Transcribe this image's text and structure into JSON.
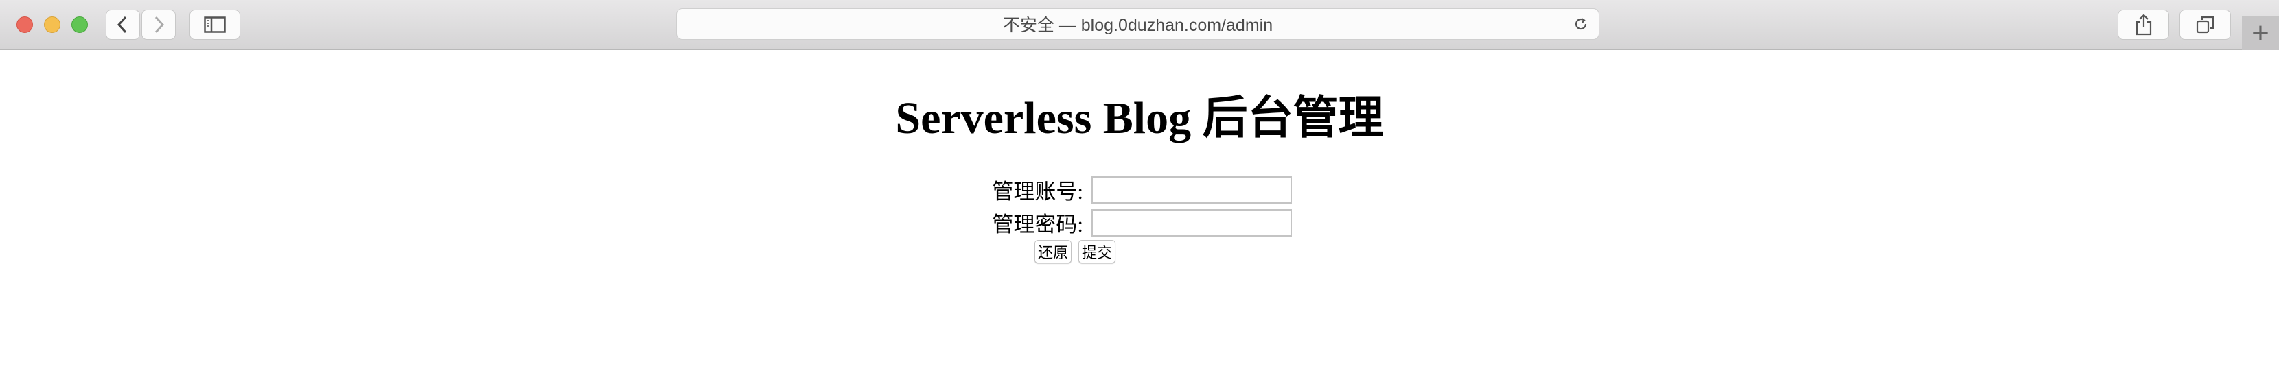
{
  "browser": {
    "url_text": "不安全 — blog.0duzhan.com/admin",
    "new_tab": "+"
  },
  "page": {
    "title": "Serverless Blog 后台管理",
    "username_label": "管理账号:",
    "username_value": "",
    "password_label": "管理密码:",
    "password_value": "",
    "reset_label": "还原",
    "submit_label": "提交"
  }
}
